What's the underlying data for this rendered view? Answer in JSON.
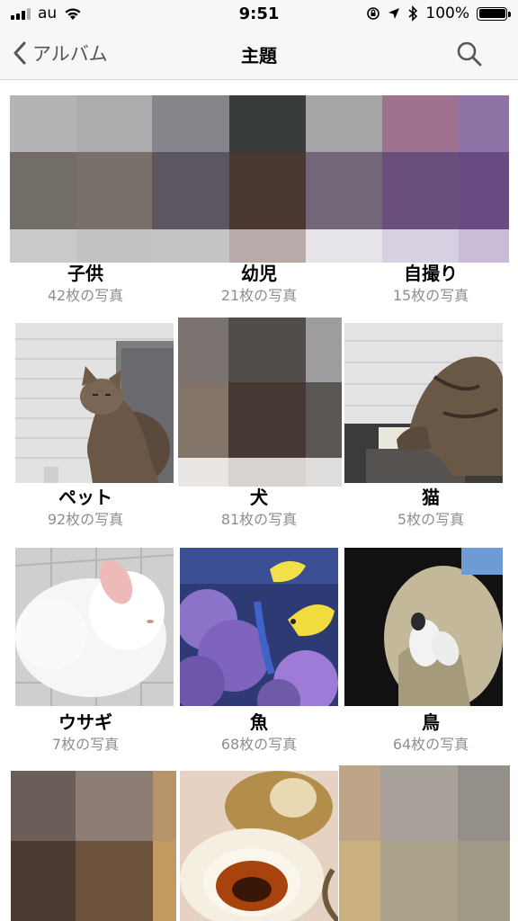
{
  "status": {
    "carrier": "au",
    "time": "9:51",
    "battery": "100%",
    "battery_level": 1.0,
    "icons": [
      "signal-icon",
      "wifi-icon",
      "rotation-lock-icon",
      "location-icon",
      "bluetooth-icon",
      "battery-icon"
    ]
  },
  "nav": {
    "back_label": "アルバム",
    "title": "主題",
    "search_icon": "search-icon"
  },
  "albums": [
    {
      "name": "子供",
      "count": "42枚の写真"
    },
    {
      "name": "幼児",
      "count": "21枚の写真"
    },
    {
      "name": "自撮り",
      "count": "15枚の写真"
    },
    {
      "name": "ペット",
      "count": "92枚の写真"
    },
    {
      "name": "犬",
      "count": "81枚の写真"
    },
    {
      "name": "猫",
      "count": "5枚の写真"
    },
    {
      "name": "ウサギ",
      "count": "7枚の写真"
    },
    {
      "name": "魚",
      "count": "68枚の写真"
    },
    {
      "name": "鳥",
      "count": "64枚の写真"
    }
  ],
  "colors": {
    "nav_background": "#f7f7f7",
    "count_text": "#8e8e93"
  }
}
